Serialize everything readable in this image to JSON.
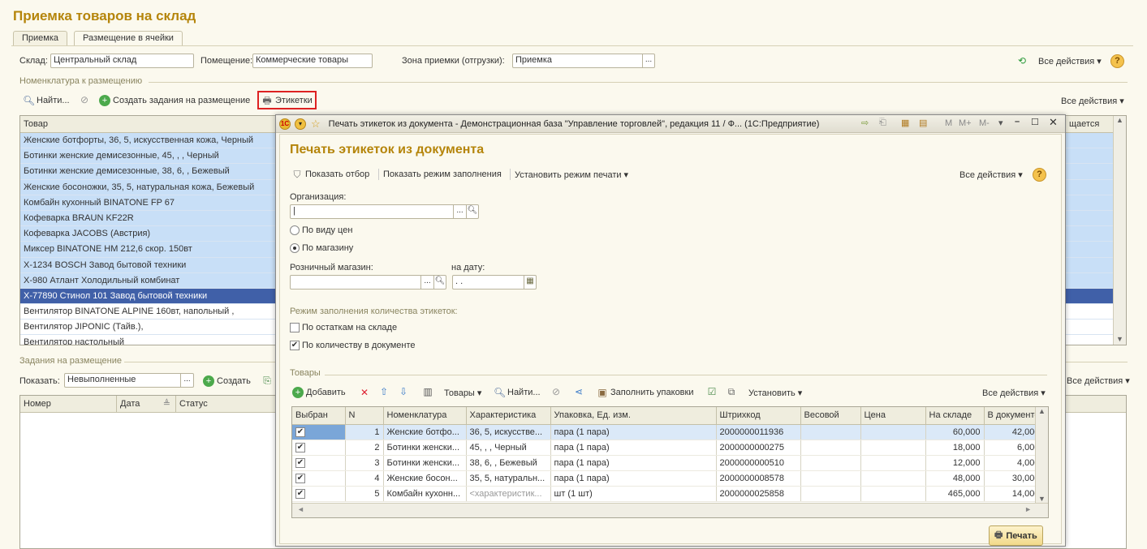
{
  "page_title": "Приемка товаров на склад",
  "tabs": [
    "Приемка",
    "Размещение в ячейки"
  ],
  "header": {
    "sklad_label": "Склад:",
    "sklad_value": "Центральный склад",
    "pomesh_label": "Помещение:",
    "pomesh_value": "Коммерческие товары",
    "zona_label": "Зона приемки (отгрузки):",
    "zona_value": "Приемка",
    "all_actions": "Все действия"
  },
  "nomenklatura": {
    "section": "Номенклатура к размещению",
    "find": "Найти...",
    "create_tasks": "Создать задания на размещение",
    "labels_btn": "Этикетки",
    "all_actions": "Все действия",
    "col_tovar": "Товар",
    "col_right": "щается",
    "rows": [
      "Женские ботфорты, 36, 5, искусственная кожа, Черный",
      "Ботинки женские демисезонные, 45, , , Черный",
      "Ботинки женские демисезонные, 38, 6, , Бежевый",
      "Женские босоножки, 35, 5, натуральная кожа, Бежевый",
      "Комбайн кухонный BINATONE FP 67",
      "Кофеварка BRAUN KF22R",
      "Кофеварка JACOBS (Австрия)",
      "Миксер BINATONE HM 212,6 скор. 150вт",
      "X-1234 BOSCH Завод бытовой техники",
      "X-980 Атлант Холодильный комбинат",
      "X-77890 Стинол 101 Завод бытовой техники",
      "Вентилятор BINATONE ALPINE 160вт, напольный ,",
      "Вентилятор JIPONIC (Тайв.),",
      "Вентилятор настольный"
    ]
  },
  "zadaniya": {
    "section": "Задания на размещение",
    "show_label": "Показать:",
    "show_value": "Невыполненные",
    "create": "Создать",
    "all_actions": "Все действия",
    "col_nomer": "Номер",
    "col_data": "Дата",
    "col_status": "Статус"
  },
  "modal": {
    "window_title": "Печать этикеток из документа - Демонстрационная база \"Управление торговлей\", редакция 11 / Ф... (1С:Предприятие)",
    "m_buttons": [
      "M",
      "M+",
      "M-"
    ],
    "heading": "Печать этикеток из документа",
    "show_filter": "Показать отбор",
    "show_fill_mode": "Показать режим заполнения",
    "set_print_mode": "Установить режим печати",
    "all_actions": "Все действия",
    "org_label": "Организация:",
    "radio_price_type": "По виду цен",
    "radio_store": "По магазину",
    "store_label": "Розничный магазин:",
    "date_label": "на дату:",
    "date_value": ". .",
    "fill_mode_label": "Режим заполнения количества этикеток:",
    "chk_stock": "По остаткам на складе",
    "chk_doc": "По количеству в документе",
    "goods_section": "Товары",
    "add": "Добавить",
    "goods_menu": "Товары",
    "find": "Найти...",
    "fill_packs": "Заполнить упаковки",
    "set_menu": "Установить",
    "print": "Печать",
    "columns": [
      "Выбран",
      "N",
      "Номенклатура",
      "Характеристика",
      "Упаковка, Ед. изм.",
      "Штрихкод",
      "Весовой",
      "Цена",
      "На складе",
      "В документе"
    ],
    "rows": [
      {
        "n": "1",
        "nom": "Женские ботфо...",
        "char": "36, 5, искусстве...",
        "pack": "пара (1 пара)",
        "barcode": "2000000011936",
        "stock": "60,000",
        "doc": "42,000"
      },
      {
        "n": "2",
        "nom": "Ботинки женски...",
        "char": "45, , , Черный",
        "pack": "пара (1 пара)",
        "barcode": "2000000000275",
        "stock": "18,000",
        "doc": "6,000"
      },
      {
        "n": "3",
        "nom": "Ботинки женски...",
        "char": "38, 6, , Бежевый",
        "pack": "пара (1 пара)",
        "barcode": "2000000000510",
        "stock": "12,000",
        "doc": "4,000"
      },
      {
        "n": "4",
        "nom": "Женские босон...",
        "char": "35, 5, натуральн...",
        "pack": "пара (1 пара)",
        "barcode": "2000000008578",
        "stock": "48,000",
        "doc": "30,000"
      },
      {
        "n": "5",
        "nom": "Комбайн кухонн...",
        "char": "<характеристик...",
        "pack": "шт (1 шт)",
        "barcode": "2000000025858",
        "stock": "465,000",
        "doc": "14,000"
      }
    ]
  }
}
